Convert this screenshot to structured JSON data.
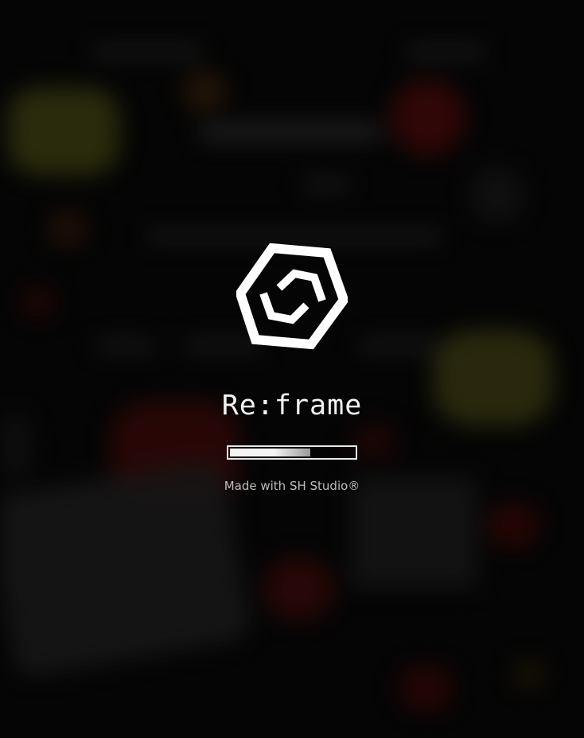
{
  "splash": {
    "app_name": "Re:frame",
    "logo_icon": "hexagon-reframe-logo-icon",
    "loading": {
      "progress_percent": 65
    },
    "credit": "Made with SH Studio®"
  },
  "colors": {
    "background": "#070707",
    "foreground": "#f2f2f2",
    "credit_text": "#bcbcbc"
  }
}
